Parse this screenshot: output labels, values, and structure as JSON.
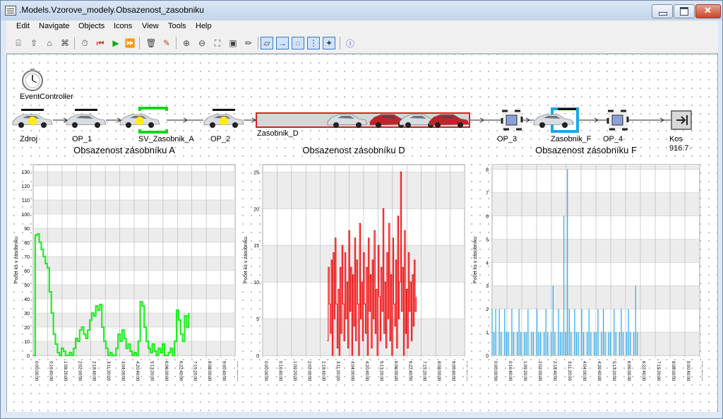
{
  "window": {
    "title": ".Models.Vzorove_modely.Obsazenost_zasobniku"
  },
  "menu": [
    "Edit",
    "Navigate",
    "Objects",
    "Icons",
    "View",
    "Tools",
    "Help"
  ],
  "toolbar": [
    "open-icon",
    "up-icon",
    "home-icon",
    "root-icon",
    "timer-icon",
    "reset-icon",
    "start-icon",
    "fast-forward-icon",
    "delete-icon",
    "broom-icon",
    "zoom-in-icon",
    "zoom-out-icon",
    "fit-icon",
    "display-icon",
    "pen-icon",
    "icon-mode-icon",
    "connector-icon",
    "comment-icon",
    "grid-icon",
    "dynamics-icon",
    "help-icon"
  ],
  "model": {
    "event_controller": "EventController",
    "objects": {
      "zdroj": "Zdroj",
      "op1": "OP_1",
      "sv_zasobnik_a": "SV_Zasobnik_A",
      "op2": "OP_2",
      "zasobnik_d": "Zasobnik_D",
      "op3": "OP_3",
      "zasobnik_f": "Zasobnik_F",
      "op4": "OP_4",
      "kos": "Kos"
    },
    "kos_value": "916.7·"
  },
  "ticks": [
    "0:00:00:00",
    "0:16:40:00",
    "1:09:20:00",
    "2:02:00:00",
    "2:18:40:00",
    "3:11:20:00",
    "4:04:00:00",
    "4:20:40:00",
    "5:13:20:00",
    "6:06:00:00",
    "6:22:40:00",
    "7:15:20:00",
    "8:08:00:00",
    "9:00:40:00",
    "9:17:20:00"
  ],
  "charts": [
    {
      "id": "A",
      "title": "Obsazenost zásobníku A",
      "ylabel": "Počet ks v zásobníku",
      "color": "#22ee22",
      "ymax": 130,
      "ystep": 10,
      "tick_labels": [
        "0",
        "10",
        "20",
        "30",
        "40",
        "50",
        "60",
        "70",
        "80",
        "90",
        "100",
        "110",
        "120",
        "130"
      ]
    },
    {
      "id": "D",
      "title": "Obsazenost zásobníku D",
      "ylabel": "Počet ks v zásobníku",
      "color": "#ee0000",
      "ymax": 25,
      "ystep": 5,
      "tick_labels": [
        "0",
        "5",
        "10",
        "15",
        "20",
        "25"
      ]
    },
    {
      "id": "F",
      "title": "Obsazenost zásobníku F",
      "ylabel": "Počet ks v zásobníku",
      "color": "#22aaee",
      "ymax": 8,
      "ystep": 1,
      "tick_labels": [
        "0",
        "1",
        "2",
        "3",
        "4",
        "5",
        "6",
        "7",
        "8"
      ]
    }
  ],
  "chart_data": [
    {
      "type": "line",
      "title": "Obsazenost zásobníku A",
      "ylabel": "Počet ks v zásobníku",
      "ylim": [
        0,
        135
      ],
      "series": [
        {
          "values": [
            0,
            85,
            86,
            80,
            75,
            70,
            65,
            62,
            45,
            30,
            15,
            8,
            2,
            0,
            5,
            3,
            0,
            0,
            2,
            0,
            5,
            12,
            10,
            18,
            20,
            15,
            12,
            18,
            25,
            30,
            28,
            35,
            32,
            36,
            20,
            10,
            5,
            0,
            2,
            0,
            0,
            5,
            15,
            10,
            18,
            12,
            5,
            8,
            3,
            0,
            2,
            0,
            10,
            38,
            35,
            20,
            10,
            5,
            2,
            8,
            3,
            0,
            5,
            2,
            8,
            0,
            0,
            2,
            5,
            0,
            10,
            32,
            25,
            15,
            10,
            28,
            20,
            30
          ]
        }
      ]
    },
    {
      "type": "line",
      "title": "Obsazenost zásobníku D",
      "ylabel": "Počet ks v zásobníku",
      "ylim": [
        0,
        26
      ],
      "series": [
        {
          "values": [
            2,
            12,
            7,
            3,
            13,
            0,
            14,
            5,
            16,
            7,
            1,
            9,
            0,
            12,
            3,
            15,
            7,
            2,
            14,
            5,
            10,
            1,
            17,
            6,
            12,
            0,
            11,
            4,
            16,
            2,
            13,
            7,
            0,
            18,
            5,
            10,
            2,
            14,
            7,
            3,
            12,
            0,
            16,
            6,
            11,
            1,
            13,
            5,
            17,
            3,
            9,
            0,
            15,
            8,
            2,
            12,
            6,
            20,
            3,
            10,
            1,
            14,
            5,
            18,
            2,
            11,
            0,
            16,
            7,
            4,
            13,
            1,
            19,
            5,
            10,
            25,
            6,
            12,
            0,
            17,
            3,
            9,
            1,
            14,
            6,
            10,
            2,
            11,
            4,
            13,
            6,
            8
          ]
        }
      ]
    },
    {
      "type": "bar",
      "title": "Obsazenost zásobníku F",
      "ylabel": "Počet ks v zásobníku",
      "ylim": [
        0,
        8.2
      ],
      "series": [
        {
          "values": [
            2,
            1,
            2,
            0,
            2,
            1,
            0,
            2,
            1,
            1,
            0,
            2,
            1,
            0,
            1,
            2,
            1,
            0,
            1,
            1,
            2,
            0,
            1,
            1,
            0,
            2,
            1,
            1,
            0,
            1,
            2,
            1,
            0,
            1,
            3,
            1,
            0,
            2,
            1,
            1,
            6,
            1,
            8,
            2,
            1,
            0,
            2,
            1,
            1,
            0,
            2,
            1,
            0,
            1,
            2,
            1,
            0,
            1,
            1,
            2,
            0,
            1,
            2,
            1,
            0,
            1,
            1,
            0,
            2,
            1,
            0,
            1,
            2,
            1,
            0,
            1,
            2,
            1,
            0,
            1,
            3,
            1
          ]
        }
      ]
    }
  ]
}
